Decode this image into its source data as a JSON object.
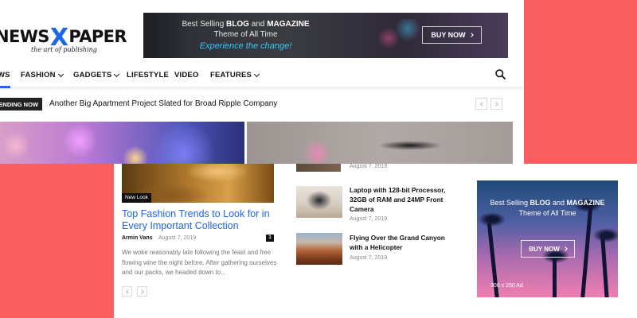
{
  "logo": {
    "text_part1": "NEWS",
    "text_x": "X",
    "text_part2": "PAPER",
    "tagline": "the art of publishing"
  },
  "header_ad": {
    "line1_pre": "Best Selling ",
    "line1_blog": "BLOG",
    "line1_and": " and ",
    "line1_magazine": "MAGAZINE",
    "line2": "Theme of All Time",
    "line3": "Experience the change!",
    "button": "BUY NOW"
  },
  "nav": {
    "items": [
      {
        "label": "WS",
        "active": true,
        "dropdown": false
      },
      {
        "label": "FASHION",
        "active": false,
        "dropdown": true
      },
      {
        "label": "GADGETS",
        "active": false,
        "dropdown": true
      },
      {
        "label": "LIFESTYLE",
        "active": false,
        "dropdown": false
      },
      {
        "label": "VIDEO",
        "active": false,
        "dropdown": false
      },
      {
        "label": "FEATURES",
        "active": false,
        "dropdown": true
      }
    ],
    "search_icon": "search-icon"
  },
  "trending": {
    "badge": "ENDING NOW",
    "headline": "Another Big Apartment Project Slated for Broad Ripple Company"
  },
  "article": {
    "category": "New Look",
    "title": "Top Fashion Trends to Look for in Every Important Collection",
    "author": "Armin Vans",
    "date": "August 7, 2019",
    "comments": "1",
    "excerpt": "We woke reasonably late following the feast and free flowing wine the night before. After gathering ourselves and our packs, we headed down to..."
  },
  "side_posts": [
    {
      "title": "",
      "date": "August 7, 2019"
    },
    {
      "title": "Laptop with 128-bit Processor, 32GB of RAM and 24MP Front Camera",
      "date": "August 7, 2019"
    },
    {
      "title": "Flying Over the Grand Canyon with a Helicopter",
      "date": "August 7, 2019"
    }
  ],
  "sidebar_ad": {
    "line1_pre": "Best Selling ",
    "line1_blog": "BLOG",
    "line1_and": " and ",
    "line1_magazine": "MAGAZINE",
    "line2": "Theme of All Time",
    "button": "BUY NOW",
    "size_label": "300 x 250 Ad"
  },
  "colors": {
    "accent": "#1e66e6",
    "coral": "#fa5e5e",
    "dark": "#111111"
  }
}
